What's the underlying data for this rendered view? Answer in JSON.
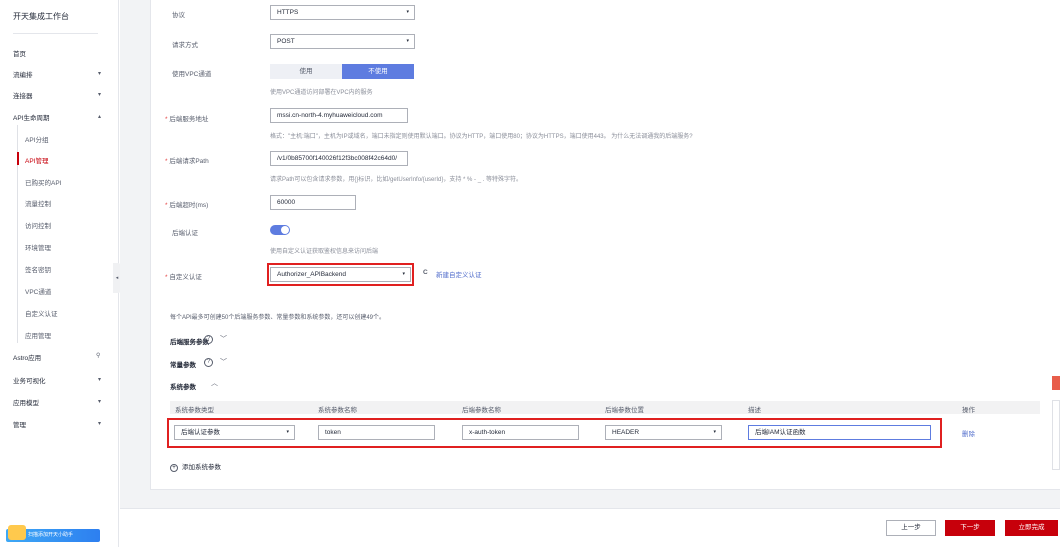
{
  "sidebar": {
    "title": "开天集成工作台",
    "items": [
      {
        "label": "首页",
        "arrow": ""
      },
      {
        "label": "流编排",
        "arrow": "▾"
      },
      {
        "label": "连接器",
        "arrow": "▾"
      },
      {
        "label": "API生命周期",
        "arrow": "▴"
      },
      {
        "label": "Astro应用",
        "arrow": "⚲"
      },
      {
        "label": "业务可视化",
        "arrow": "▾"
      },
      {
        "label": "应用模型",
        "arrow": "▾"
      },
      {
        "label": "管理",
        "arrow": "▾"
      }
    ],
    "sub_items": [
      "API分组",
      "API管理",
      "已购买的API",
      "流量控制",
      "访问控制",
      "环境管理",
      "签名密钥",
      "VPC通道",
      "自定义认证",
      "应用管理"
    ],
    "active_sub": "API管理",
    "banner_text": "扫描添加开天小助手",
    "collapse_glyph": "◂"
  },
  "form": {
    "protocol_label": "协议",
    "protocol_value": "HTTPS",
    "method_label": "请求方式",
    "method_value": "POST",
    "vpc_label": "使用VPC通道",
    "vpc_on": "使用",
    "vpc_off": "不使用",
    "vpc_hint": "使用VPC通道访问部署在VPC内的服务",
    "address_label": "后端服务地址",
    "address_value": "mssi.cn-north-4.myhuaweicloud.com",
    "address_hint": "格式：\"主机:端口\"，主机为IP或域名，端口未指定则使用默认端口。协议为HTTP，端口使用80；协议为HTTPS，端口使用443。 为什么无法调通我的后端服务?",
    "path_label": "后端请求Path",
    "path_value": "/v1/0b85700f140026f12f3bc008f42c64d0/",
    "path_hint": "请求Path可以包含请求参数，用{}标识，比如/getUserInfo/{userId}，支持 * % - _ . 等特殊字符。",
    "timeout_label": "后端超时(ms)",
    "timeout_value": "60000",
    "auth_label": "后端认证",
    "auth_hint": "使用自定义认证获取鉴权信息来访问后端",
    "custom_auth_label": "自定义认证",
    "custom_auth_value": "Authorizer_APIBackend",
    "refresh_icon": "C",
    "new_auth_link": "新建自定义认证",
    "required_mark": "*",
    "select_arrow": "▾"
  },
  "params": {
    "limit_hint": "每个API最多可创建50个后端服务参数、常量参数和系统参数，还可以创建49个。",
    "backend_params": "后端服务参数",
    "constant_params": "常量参数",
    "system_params": "系统参数",
    "help_glyph": "?",
    "chevron_down": "﹀",
    "chevron_up": "︿",
    "columns": [
      "系统参数类型",
      "系统参数名称",
      "后端参数名称",
      "后端参数位置",
      "描述",
      "操作"
    ],
    "row": {
      "type": "后端认证参数",
      "name": "token",
      "backend_name": "x-auth-token",
      "position": "HEADER",
      "description": "后端IAM认证函数",
      "action": "删除"
    },
    "add_label": "添加系统参数",
    "add_glyph": "+"
  },
  "footer": {
    "prev": "上一步",
    "next": "下一步",
    "done": "立即完成"
  }
}
